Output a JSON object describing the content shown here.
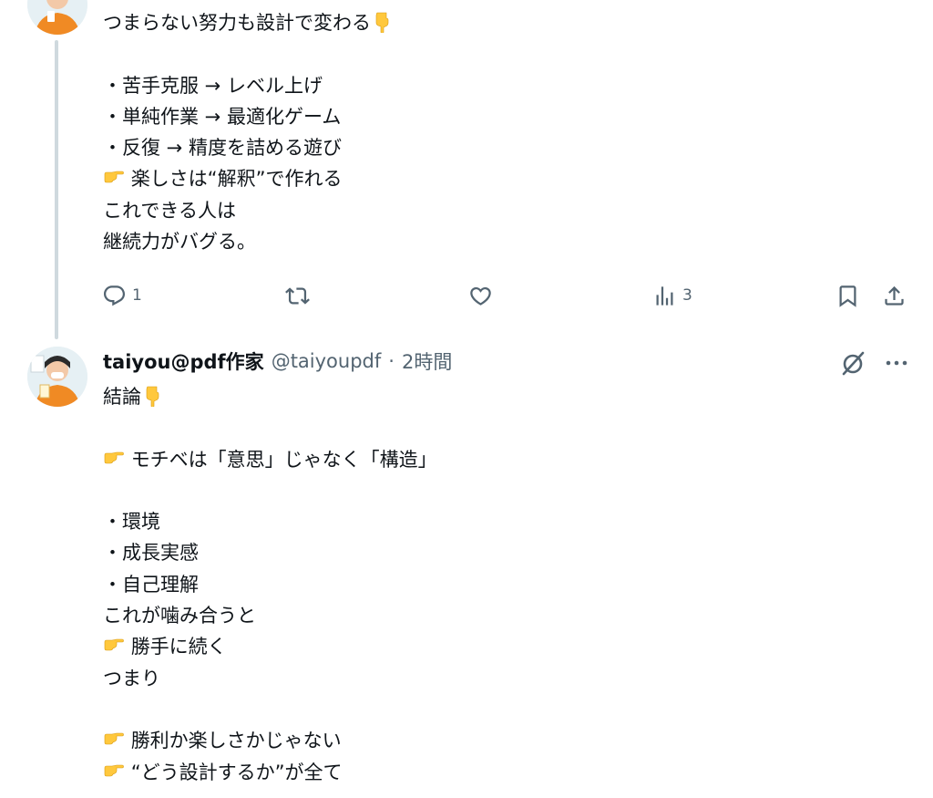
{
  "tweet1": {
    "lines": [
      "つまらない努力も設計で変わる",
      "",
      "・苦手克服 → レベル上げ",
      "・単純作業 → 最適化ゲーム",
      "・反復 → 精度を詰める遊び",
      "楽しさは“解釈”で作れる",
      "これできる人は",
      "継続力がバグる。"
    ],
    "actions": {
      "reply_count": "1",
      "retweet_count": "",
      "like_count": "",
      "views_count": "3"
    }
  },
  "tweet2": {
    "display_name": "taiyou@pdf作家",
    "handle": "@taiyoupdf",
    "separator": "·",
    "time": "2時間",
    "lines": [
      "結論",
      "",
      "モチベは「意思」じゃなく「構造」",
      "",
      "・環境",
      "・成長実感",
      "・自己理解",
      "これが噛み合うと",
      "勝手に続く",
      "つまり",
      "",
      "勝利か楽しさかじゃない",
      "“どう設計するか”が全て"
    ]
  },
  "icons": {
    "reply": "reply-icon",
    "retweet": "retweet-icon",
    "like": "heart-icon",
    "views": "views-icon",
    "bookmark": "bookmark-icon",
    "share": "share-icon",
    "grok": "grok-icon",
    "more": "more-icon",
    "emoji_down": "backhand-index-pointing-down-emoji",
    "emoji_right": "backhand-index-pointing-right-emoji"
  },
  "colors": {
    "text": "#0f1419",
    "secondary": "#536471",
    "thread_line": "#cfd9de",
    "emoji_hand": "#ffc83d"
  }
}
